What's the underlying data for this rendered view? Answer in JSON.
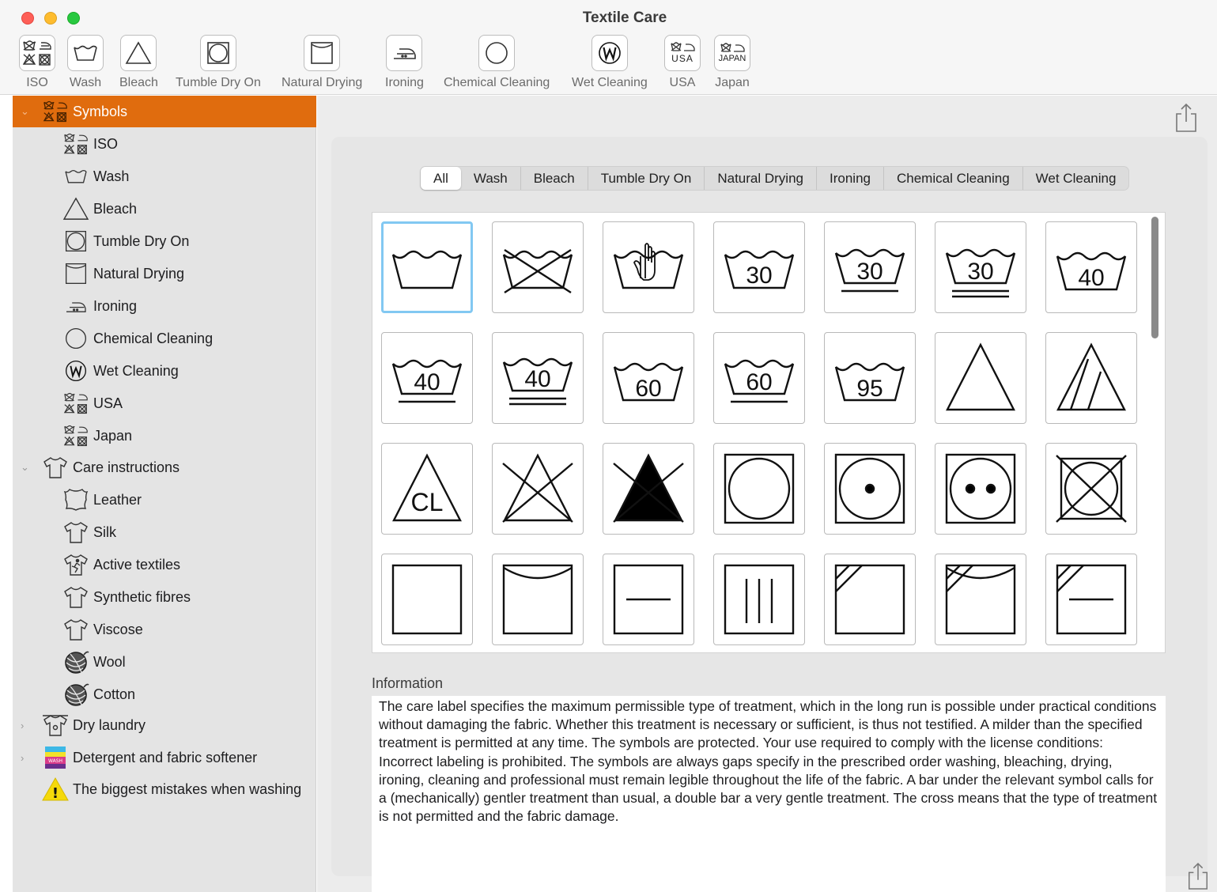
{
  "window": {
    "title": "Textile Care"
  },
  "toolbar": {
    "items": [
      {
        "label": "ISO",
        "icon": "iso-symbols-icon"
      },
      {
        "label": "Wash",
        "icon": "wash-tub-icon"
      },
      {
        "label": "Bleach",
        "icon": "bleach-triangle-icon"
      },
      {
        "label": "Tumble Dry On",
        "icon": "tumble-dry-icon"
      },
      {
        "label": "Natural Drying",
        "icon": "natural-drying-icon"
      },
      {
        "label": "Ironing",
        "icon": "iron-icon"
      },
      {
        "label": "Chemical Cleaning",
        "icon": "chemical-cleaning-circle-icon"
      },
      {
        "label": "Wet Cleaning",
        "icon": "wet-cleaning-w-icon"
      },
      {
        "label": "USA",
        "icon": "usa-symbols-icon",
        "badge": "USA"
      },
      {
        "label": "Japan",
        "icon": "japan-symbols-icon",
        "badge": "JAPAN"
      }
    ]
  },
  "sidebar": {
    "items": [
      {
        "label": "Symbols",
        "level": 0,
        "selected": true
      },
      {
        "label": "ISO",
        "level": 1
      },
      {
        "label": "Wash",
        "level": 1
      },
      {
        "label": "Bleach",
        "level": 1
      },
      {
        "label": "Tumble Dry On",
        "level": 1
      },
      {
        "label": "Natural Drying",
        "level": 1
      },
      {
        "label": "Ironing",
        "level": 1
      },
      {
        "label": "Chemical Cleaning",
        "level": 1
      },
      {
        "label": "Wet Cleaning",
        "level": 1
      },
      {
        "label": "USA",
        "level": 1
      },
      {
        "label": "Japan",
        "level": 1
      },
      {
        "label": "Care instructions",
        "level": 0,
        "expanded": true
      },
      {
        "label": "Leather",
        "level": 1
      },
      {
        "label": "Silk",
        "level": 1
      },
      {
        "label": "Active textiles",
        "level": 1
      },
      {
        "label": "Synthetic fibres",
        "level": 1
      },
      {
        "label": "Viscose",
        "level": 1
      },
      {
        "label": "Wool",
        "level": 1
      },
      {
        "label": "Cotton",
        "level": 1
      },
      {
        "label": "Dry laundry",
        "level": 0,
        "expanded": false
      },
      {
        "label": "Detergent and fabric softener",
        "level": 0,
        "expanded": false,
        "badge": "WASH"
      },
      {
        "label": "The biggest mistakes when washing",
        "level": 0,
        "badge": "!"
      }
    ]
  },
  "filter": {
    "segments": [
      "All",
      "Wash",
      "Bleach",
      "Tumble Dry On",
      "Natural Drying",
      "Ironing",
      "Chemical Cleaning",
      "Wet Cleaning"
    ],
    "selected": "All"
  },
  "symbols": [
    {
      "icon": "wash-icon"
    },
    {
      "icon": "do-not-wash-icon"
    },
    {
      "icon": "hand-wash-icon"
    },
    {
      "icon": "wash-30-icon",
      "temp": "30",
      "bars": 0
    },
    {
      "icon": "wash-30-gentle-icon",
      "temp": "30",
      "bars": 1
    },
    {
      "icon": "wash-30-very-gentle-icon",
      "temp": "30",
      "bars": 2
    },
    {
      "icon": "wash-40-icon",
      "temp": "40",
      "bars": 0
    },
    {
      "icon": "wash-40-gentle-icon",
      "temp": "40",
      "bars": 1
    },
    {
      "icon": "wash-40-very-gentle-icon",
      "temp": "40",
      "bars": 2
    },
    {
      "icon": "wash-60-icon",
      "temp": "60",
      "bars": 0
    },
    {
      "icon": "wash-60-gentle-icon",
      "temp": "60",
      "bars": 1
    },
    {
      "icon": "wash-95-icon",
      "temp": "95",
      "bars": 0
    },
    {
      "icon": "bleach-any-icon"
    },
    {
      "icon": "bleach-oxygen-only-icon"
    },
    {
      "icon": "bleach-chlorine-icon",
      "text": "CL"
    },
    {
      "icon": "do-not-bleach-icon"
    },
    {
      "icon": "do-not-bleach-filled-icon"
    },
    {
      "icon": "tumble-dry-icon"
    },
    {
      "icon": "tumble-dry-low-icon"
    },
    {
      "icon": "tumble-dry-normal-icon"
    },
    {
      "icon": "do-not-tumble-dry-icon"
    },
    {
      "icon": "dry-icon"
    },
    {
      "icon": "line-dry-icon"
    },
    {
      "icon": "dry-flat-icon"
    },
    {
      "icon": "drip-dry-icon"
    },
    {
      "icon": "dry-in-shade-icon"
    },
    {
      "icon": "line-dry-in-shade-icon"
    },
    {
      "icon": "dry-flat-in-shade-icon"
    }
  ],
  "information": {
    "label": "Information",
    "text": "The care label specifies the maximum permissible type of treatment, which in the long run is possible under practical conditions without damaging the fabric. Whether this treatment is necessary or sufficient, is thus not testified. A milder than the specified treatment is permitted at any time. The symbols are protected. Your use required to comply with the license conditions: Incorrect labeling is prohibited. The symbols are always gaps specify in the prescribed order washing, bleaching, drying, ironing, cleaning and professional must remain legible throughout the life of the fabric. A bar under the relevant symbol calls for a (mechanically) gentler treatment than usual, a double bar a very gentle treatment. The cross means that the type of treatment is not permitted and the fabric damage."
  },
  "colors": {
    "accent": "#e06c0e",
    "selection_ring": "#82c8f2",
    "sidebar_bg": "#e4e4e4",
    "toolbar_bg": "#f6f6f6"
  }
}
